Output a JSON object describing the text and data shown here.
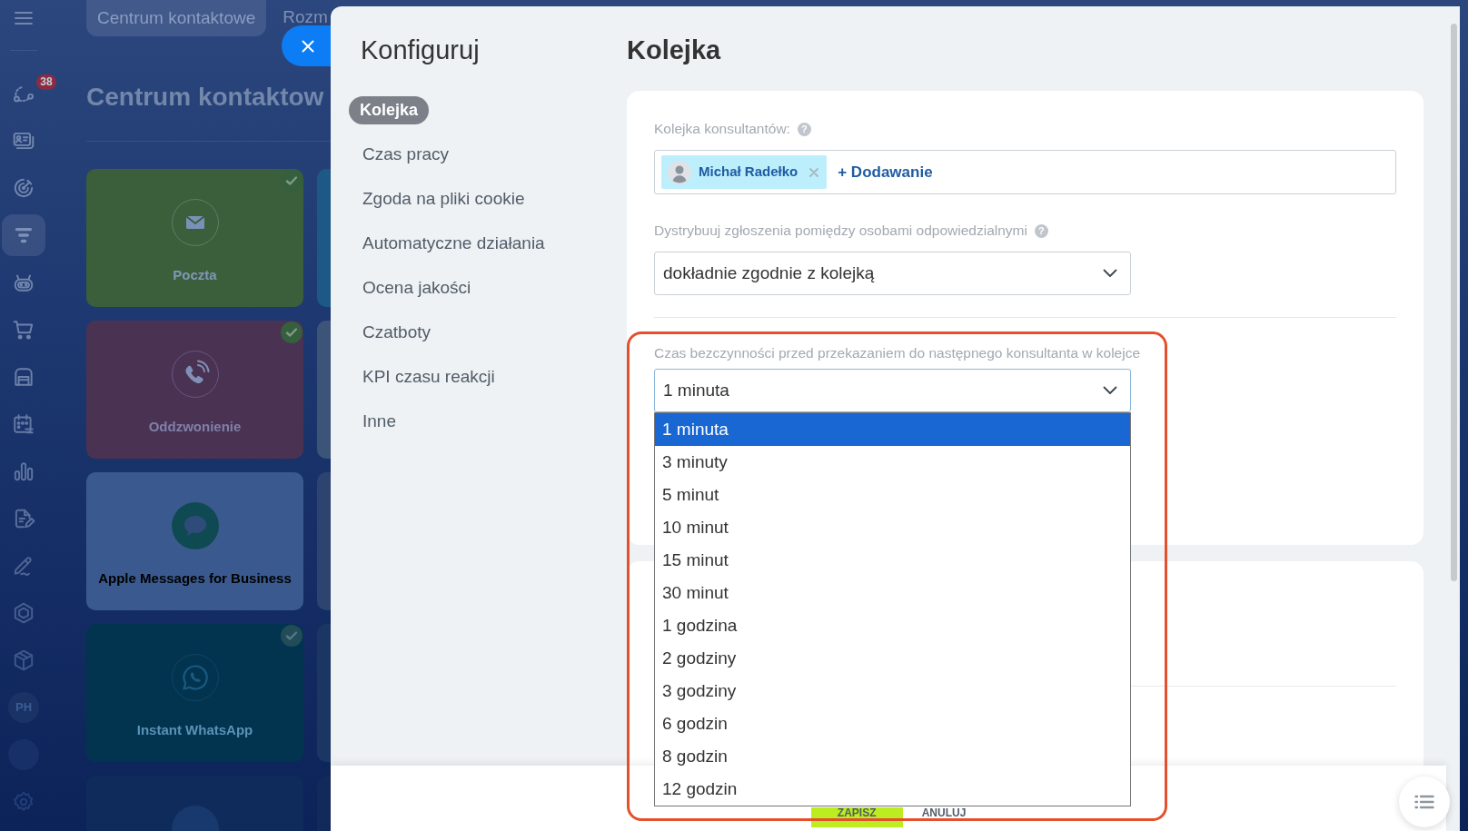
{
  "page": {
    "top_tabs": [
      {
        "label": "Centrum kontaktowe",
        "selected": true
      },
      {
        "label": "Rozm",
        "selected": false
      }
    ],
    "nav": {
      "items": [
        {
          "selected": false,
          "badge": "38"
        },
        {
          "selected": false
        },
        {
          "selected": false
        },
        {
          "selected": true
        },
        {
          "selected": false
        },
        {
          "selected": false
        },
        {
          "selected": false
        },
        {
          "selected": false
        },
        {
          "selected": false
        },
        {
          "selected": false
        },
        {
          "selected": false
        },
        {
          "selected": false
        },
        {
          "selected": false
        }
      ],
      "avatar": "PH"
    },
    "title": "Centrum kontaktow",
    "channels": [
      {
        "label": "Poczta",
        "connected": true,
        "color": "#3b5e3b"
      },
      {
        "label": "Oddzwonienie",
        "connected": true,
        "color": "#4a3253"
      },
      {
        "label": "Apple Messages for Business",
        "connected": false,
        "color": "#3a5a8f"
      },
      {
        "label": "Instant WhatsApp",
        "connected": true,
        "color": "#03344f"
      },
      {
        "connected": false,
        "color": "#0f2b5c"
      }
    ],
    "channels_cut": [
      {
        "color": "#1e5886"
      },
      {
        "color": "#3d5479"
      },
      {
        "color": "#2c446f"
      },
      {
        "color": "#1c3664"
      },
      {
        "color": "#112a5a"
      }
    ]
  },
  "panel": {
    "title": "Konfiguruj",
    "menu": [
      {
        "label": "Kolejka",
        "selected": true
      },
      {
        "label": "Czas pracy",
        "selected": false
      },
      {
        "label": "Zgoda na pliki cookie",
        "selected": false
      },
      {
        "label": "Automatyczne działania",
        "selected": false
      },
      {
        "label": "Ocena jakości",
        "selected": false
      },
      {
        "label": "Czatboty",
        "selected": false
      },
      {
        "label": "KPI czasu reakcji",
        "selected": false
      },
      {
        "label": "Inne",
        "selected": false
      }
    ],
    "heading": "Kolejka",
    "queue": {
      "label": "Kolejka konsultantów:",
      "help": "?",
      "members": [
        {
          "name": "Michał Radełko"
        }
      ],
      "add_label": "+ Dodawanie"
    },
    "distribution": {
      "label": "Dystrybuuj zgłoszenia pomiędzy osobami odpowiedzialnymi",
      "help": "?",
      "value": "dokładnie zgodnie z kolejką"
    },
    "idle_timeout": {
      "label": "Czas bezczynności przed przekazaniem do następnego konsultanta w kolejce",
      "value": "1 minuta",
      "expanded": true,
      "highlighted": true,
      "options": [
        {
          "label": "1 minuta",
          "selected": true
        },
        {
          "label": "3 minuty",
          "selected": false
        },
        {
          "label": "5 minut",
          "selected": false
        },
        {
          "label": "10 minut",
          "selected": false
        },
        {
          "label": "15 minut",
          "selected": false
        },
        {
          "label": "30 minut",
          "selected": false
        },
        {
          "label": "1 godzina",
          "selected": false
        },
        {
          "label": "2 godziny",
          "selected": false
        },
        {
          "label": "3 godziny",
          "selected": false
        },
        {
          "label": "6 godzin",
          "selected": false
        },
        {
          "label": "8 godzin",
          "selected": false
        },
        {
          "label": "12 godzin",
          "selected": false
        }
      ]
    },
    "footer_buttons": [
      {
        "label": "ZAPISZ",
        "kind": "primary"
      },
      {
        "label": "ANULUJ",
        "kind": "link"
      }
    ]
  }
}
